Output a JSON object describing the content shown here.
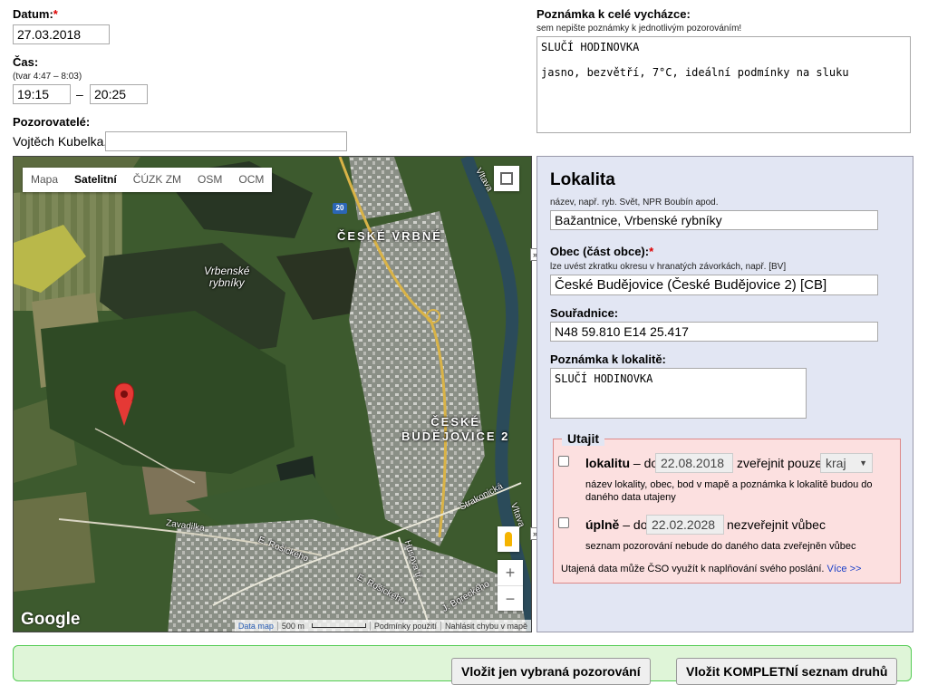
{
  "datum": {
    "label": "Datum:",
    "required_mark": "*",
    "value": "27.03.2018"
  },
  "cas": {
    "label": "Čas:",
    "hint": "(tvar 4:47 – 8:03)",
    "from": "19:15",
    "separator": "–",
    "to": "20:25"
  },
  "pozorovatele": {
    "label": "Pozorovatelé:",
    "names": "Vojtěch Kubelka,",
    "extra_value": ""
  },
  "poznamka_vychazka": {
    "label": "Poznámka k celé vycházce:",
    "hint": "sem nepište poznámky k jednotlivým pozorováním!",
    "value": "SLUČÍ HODINOVKA\n\njasno, bezvětří, 7°C, ideální podmínky na sluku"
  },
  "map": {
    "tabs": [
      "Mapa",
      "Satelitní",
      "ČÚZK ZM",
      "OSM",
      "OCM"
    ],
    "active_tab": "Satelitní",
    "labels": {
      "ceske_vrbne": "ČESKÉ VRBNÉ",
      "vrbenske_1": "Vrbenské",
      "vrbenske_2": "rybníky",
      "cb2_1": "ČESKÉ",
      "cb2_2": "BUDĚJOVICE 2",
      "road_number": "20",
      "vltava": "Vltava",
      "vltava2": "Vltava",
      "zavadilka": "Zavadilka",
      "rosickeho1": "E. Rošického",
      "rosickeho2": "E. Rošického",
      "strakonicka": "Strakonická",
      "husova": "Husova tř.",
      "boreckeho": "J. Boreckého"
    },
    "logo": "Google",
    "footer": {
      "data": "Data map",
      "scale": "500 m",
      "terms": "Podmínky použití",
      "report": "Nahlásit chybu v mapě"
    },
    "zoom_in": "+",
    "zoom_out": "−",
    "colors": {
      "marker": "#e53935",
      "forest": "#2f4a25"
    }
  },
  "lokalita": {
    "title": "Lokalita",
    "nazev_hint": "název, např. ryb. Svět, NPR Boubín apod.",
    "nazev_value": "Bažantnice, Vrbenské rybníky",
    "obec_label": "Obec (část obce):",
    "obec_required": "*",
    "obec_hint": "lze uvést zkratku okresu v hranatých závorkách, např. [BV]",
    "obec_value": "České Budějovice (České Budějovice 2) [CB]",
    "souradnice_label": "Souřadnice:",
    "souradnice_value": "N48 59.810 E14 25.417",
    "poznamka_label": "Poznámka k lokalitě:",
    "poznamka_value": "SLUČÍ HODINOVKA"
  },
  "utajit": {
    "legend": "Utajit",
    "lokalitu_label": "lokalitu",
    "lokalitu_do": "– do",
    "lokalitu_date": "22.08.2018",
    "zverejnit_pouze": "zveřejnit pouze",
    "select_value": "kraj",
    "lokalitu_hint": "název lokality, obec, bod v mapě a poznámka k lokalitě budou do daného data utajeny",
    "uplne_label": "úplně",
    "uplne_do": "– do",
    "uplne_date": "22.02.2028",
    "nezverejnit": "nezveřejnit vůbec",
    "uplne_hint": "seznam pozorování nebude do daného data zveřejněn vůbec",
    "info": "Utajená data může ČSO využít k naplňování svého poslání.",
    "more_link": "Více >>"
  },
  "buttons": {
    "vybrana": "Vložit jen vybraná pozorování",
    "kompletni": "Vložit KOMPLETNÍ seznam druhů"
  }
}
